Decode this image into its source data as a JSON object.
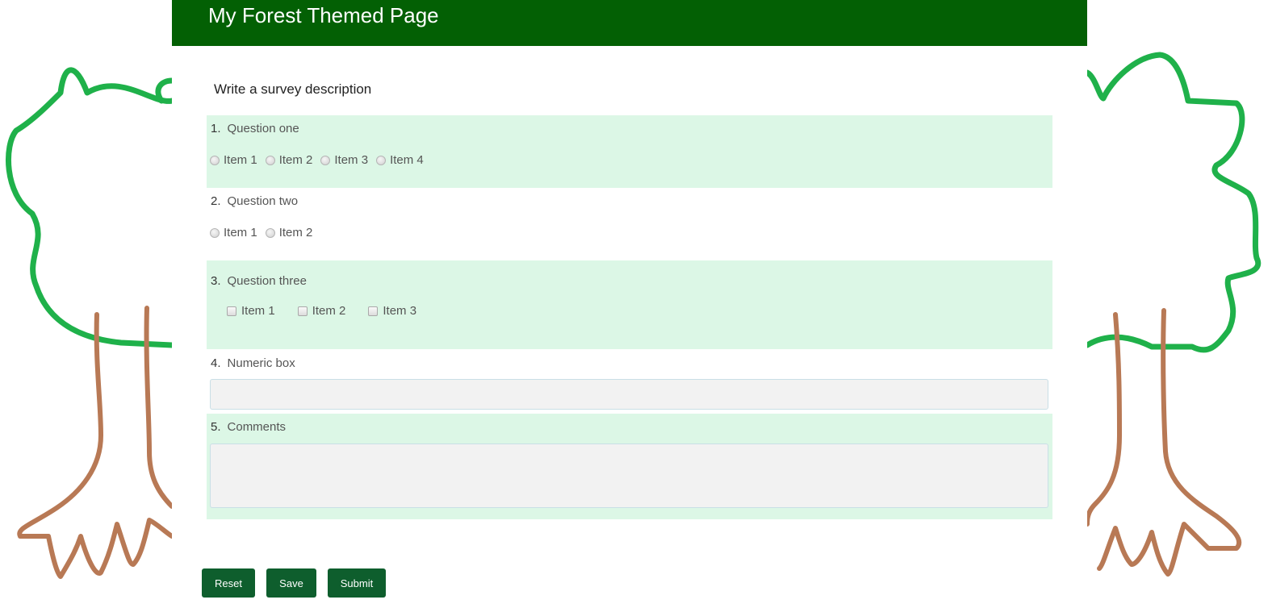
{
  "header": {
    "title": "My Forest Themed Page"
  },
  "survey": {
    "description": "Write a survey description",
    "questions": [
      {
        "num": "1.",
        "title": "Question one",
        "type": "radiogroup",
        "options": [
          "Item 1",
          "Item 2",
          "Item 3",
          "Item 4"
        ]
      },
      {
        "num": "2.",
        "title": "Question two",
        "type": "radiogroup",
        "options": [
          "Item 1",
          "Item 2"
        ]
      },
      {
        "num": "3.",
        "title": "Question three",
        "type": "checkbox",
        "options": [
          "Item 1",
          "Item 2",
          "Item 3"
        ]
      },
      {
        "num": "4.",
        "title": "Numeric box",
        "type": "text",
        "value": ""
      },
      {
        "num": "5.",
        "title": "Comments",
        "type": "comment",
        "value": ""
      }
    ]
  },
  "buttons": {
    "reset": "Reset",
    "save": "Save",
    "submit": "Submit"
  },
  "colors": {
    "header": "#036004",
    "alt_row": "#dcf7e6",
    "button": "#0e5e2d",
    "tree_canopy": "#1fb14a",
    "tree_trunk": "#b87955"
  },
  "decor": {
    "left_icon": "tree-icon",
    "right_icon": "tree-icon"
  }
}
